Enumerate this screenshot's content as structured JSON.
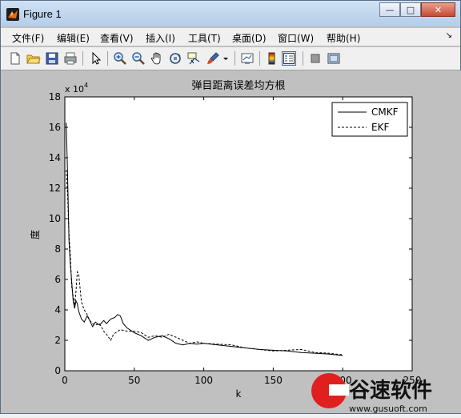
{
  "window": {
    "title": "Figure 1",
    "buttons": {
      "minimize": "—",
      "maximize": "□",
      "close": "✕"
    }
  },
  "menu": [
    "文件(F)",
    "编辑(E)",
    "查看(V)",
    "插入(I)",
    "工具(T)",
    "桌面(D)",
    "窗口(W)",
    "帮助(H)"
  ],
  "menu_dock_icon": "dock-arrow-icon",
  "toolbar_icons": [
    "new-file-icon",
    "open-folder-icon",
    "save-icon",
    "print-icon",
    "pointer-icon",
    "zoom-in-icon",
    "zoom-out-icon",
    "pan-hand-icon",
    "rotate-icon",
    "data-cursor-icon",
    "brush-icon",
    "link-icon",
    "colorbar-icon",
    "legend-icon",
    "hide-plot-tools-icon",
    "show-plot-tools-icon"
  ],
  "watermark": {
    "text": "谷速软件",
    "url": "www.gusuoft.com"
  },
  "chart_data": {
    "type": "line",
    "title": "弹目距离误差均方根",
    "xlabel": "k",
    "ylabel": "度",
    "exponent_label": "x 10",
    "exponent_power": "4",
    "xlim": [
      0,
      250
    ],
    "ylim": [
      0,
      18
    ],
    "x_ticks": [
      "0",
      "50",
      "100",
      "150",
      "200",
      "250"
    ],
    "y_ticks": [
      "0",
      "2",
      "4",
      "6",
      "8",
      "10",
      "12",
      "14",
      "16",
      "18"
    ],
    "legend_position": "top-right",
    "series": [
      {
        "name": "CMKF",
        "style": "solid",
        "x": [
          1,
          2,
          3,
          4,
          5,
          6,
          7,
          8,
          9,
          10,
          12,
          14,
          16,
          18,
          20,
          22,
          25,
          28,
          30,
          33,
          36,
          38,
          40,
          42,
          45,
          50,
          55,
          60,
          65,
          70,
          75,
          80,
          85,
          90,
          95,
          100,
          110,
          120,
          130,
          140,
          150,
          160,
          170,
          180,
          190,
          200
        ],
        "y": [
          16.3,
          12.8,
          8.5,
          7.0,
          5.8,
          4.6,
          4.1,
          4.6,
          4.4,
          3.9,
          3.4,
          3.2,
          3.6,
          3.3,
          2.9,
          3.2,
          3.0,
          3.3,
          3.1,
          3.4,
          3.5,
          3.7,
          3.6,
          3.1,
          2.8,
          2.5,
          2.3,
          2.0,
          2.2,
          2.3,
          2.1,
          1.8,
          1.7,
          1.8,
          1.75,
          1.8,
          1.7,
          1.6,
          1.5,
          1.4,
          1.35,
          1.3,
          1.2,
          1.15,
          1.1,
          1.0
        ]
      },
      {
        "name": "EKF",
        "style": "dashed",
        "x": [
          1,
          2,
          3,
          4,
          5,
          6,
          7,
          8,
          9,
          10,
          11,
          12,
          14,
          16,
          18,
          20,
          22,
          25,
          28,
          30,
          33,
          35,
          38,
          40,
          45,
          50,
          55,
          60,
          65,
          70,
          75,
          80,
          85,
          90,
          95,
          100,
          110,
          120,
          130,
          140,
          150,
          160,
          170,
          180,
          190,
          200
        ],
        "y": [
          13.2,
          11.5,
          9.0,
          7.5,
          5.5,
          4.9,
          4.3,
          5.2,
          6.5,
          6.3,
          5.4,
          4.5,
          4.0,
          3.7,
          3.3,
          3.1,
          3.0,
          3.1,
          2.6,
          2.4,
          2.0,
          2.4,
          2.6,
          2.7,
          2.6,
          2.6,
          2.5,
          2.2,
          2.3,
          2.2,
          2.4,
          2.2,
          2.0,
          1.8,
          1.9,
          1.8,
          1.75,
          1.7,
          1.5,
          1.4,
          1.3,
          1.35,
          1.4,
          1.2,
          1.15,
          1.05
        ]
      }
    ]
  }
}
